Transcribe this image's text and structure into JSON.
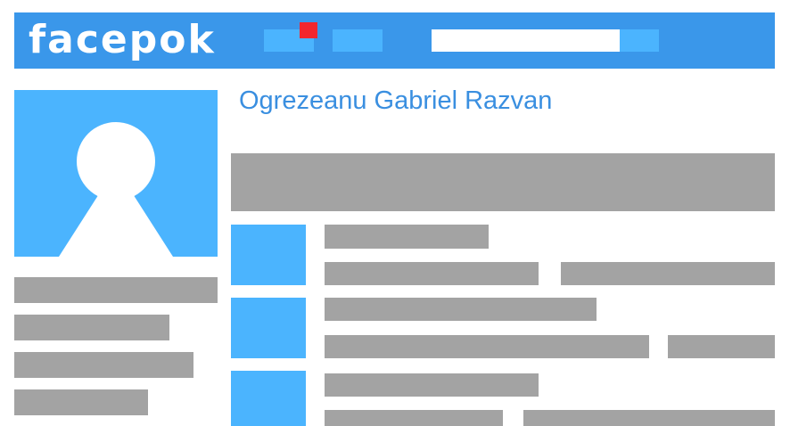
{
  "header": {
    "logo_text": "facepok",
    "bar_color": "#3a97ea",
    "notification_color": "#f2262d",
    "search": {
      "value": "",
      "placeholder": ""
    }
  },
  "profile": {
    "name": "Ogrezeanu Gabriel Razvan",
    "avatar_icon": "user-silhouette-icon",
    "name_color": "#3a8fe0"
  },
  "colors": {
    "accent": "#4bb4fe",
    "placeholder_gray": "#a3a3a3"
  }
}
